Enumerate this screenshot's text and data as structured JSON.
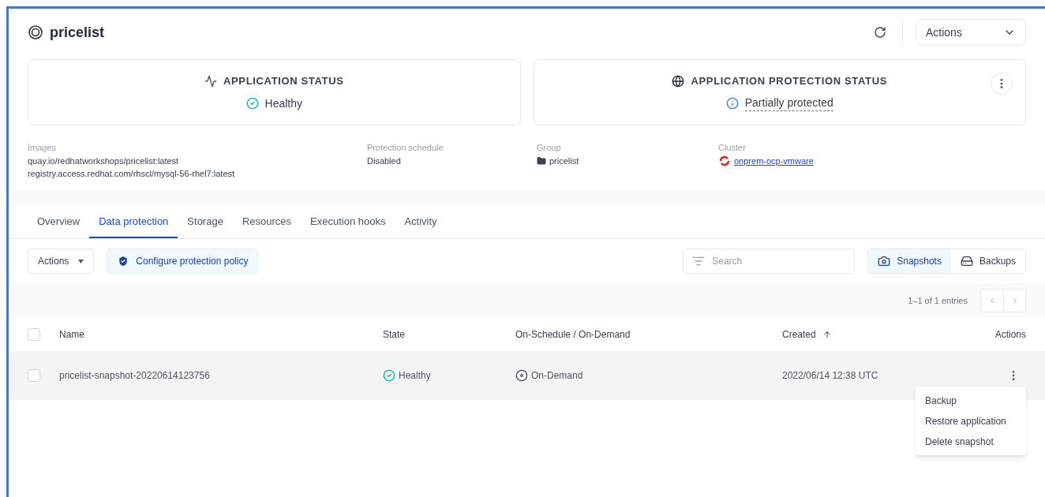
{
  "header": {
    "title": "pricelist",
    "actions_label": "Actions"
  },
  "status_cards": [
    {
      "kind": "app",
      "title": "APPLICATION STATUS",
      "value": "Healthy",
      "menu": false
    },
    {
      "kind": "protection",
      "title": "APPLICATION PROTECTION STATUS",
      "value": "Partially protected",
      "menu": true
    }
  ],
  "details": [
    {
      "kind": "images",
      "label": "Images",
      "values": [
        "quay.io/redhatworkshops/pricelist:latest",
        "registry.access.redhat.com/rhscl/mysql-56-rhel7:latest"
      ]
    },
    {
      "kind": "text",
      "label": "Protection schedule",
      "values": [
        "Disabled"
      ]
    },
    {
      "kind": "group",
      "label": "Group",
      "values": [
        "pricelist"
      ]
    },
    {
      "kind": "cluster",
      "label": "Cluster",
      "values": [
        "onprem-ocp-vmware"
      ]
    }
  ],
  "tabs": [
    {
      "label": "Overview",
      "selected": false
    },
    {
      "label": "Data protection",
      "selected": true
    },
    {
      "label": "Storage",
      "selected": false
    },
    {
      "label": "Resources",
      "selected": false
    },
    {
      "label": "Execution hooks",
      "selected": false
    },
    {
      "label": "Activity",
      "selected": false
    }
  ],
  "toolbar": {
    "actions_label": "Actions",
    "configure_label": "Configure protection policy",
    "search": {
      "placeholder": "Search"
    },
    "views": [
      {
        "kind": "snapshots",
        "label": "Snapshots",
        "selected": true
      },
      {
        "kind": "backups",
        "label": "Backups",
        "selected": false
      }
    ]
  },
  "pagination": {
    "text": "1–1 of 1 entries"
  },
  "table": {
    "select_all_checked": false,
    "columns": [
      "Name",
      "State",
      "On-Schedule / On-Demand",
      "Created",
      "Actions"
    ],
    "rows": [
      {
        "name": "pricelist-snapshot-20220614123756",
        "state": "Healthy",
        "schedule": "On-Demand",
        "created": "2022/06/14 12:38 UTC",
        "checked": false
      }
    ]
  },
  "row_menu": {
    "items": [
      "Backup",
      "Restore application",
      "Delete snapshot"
    ]
  }
}
